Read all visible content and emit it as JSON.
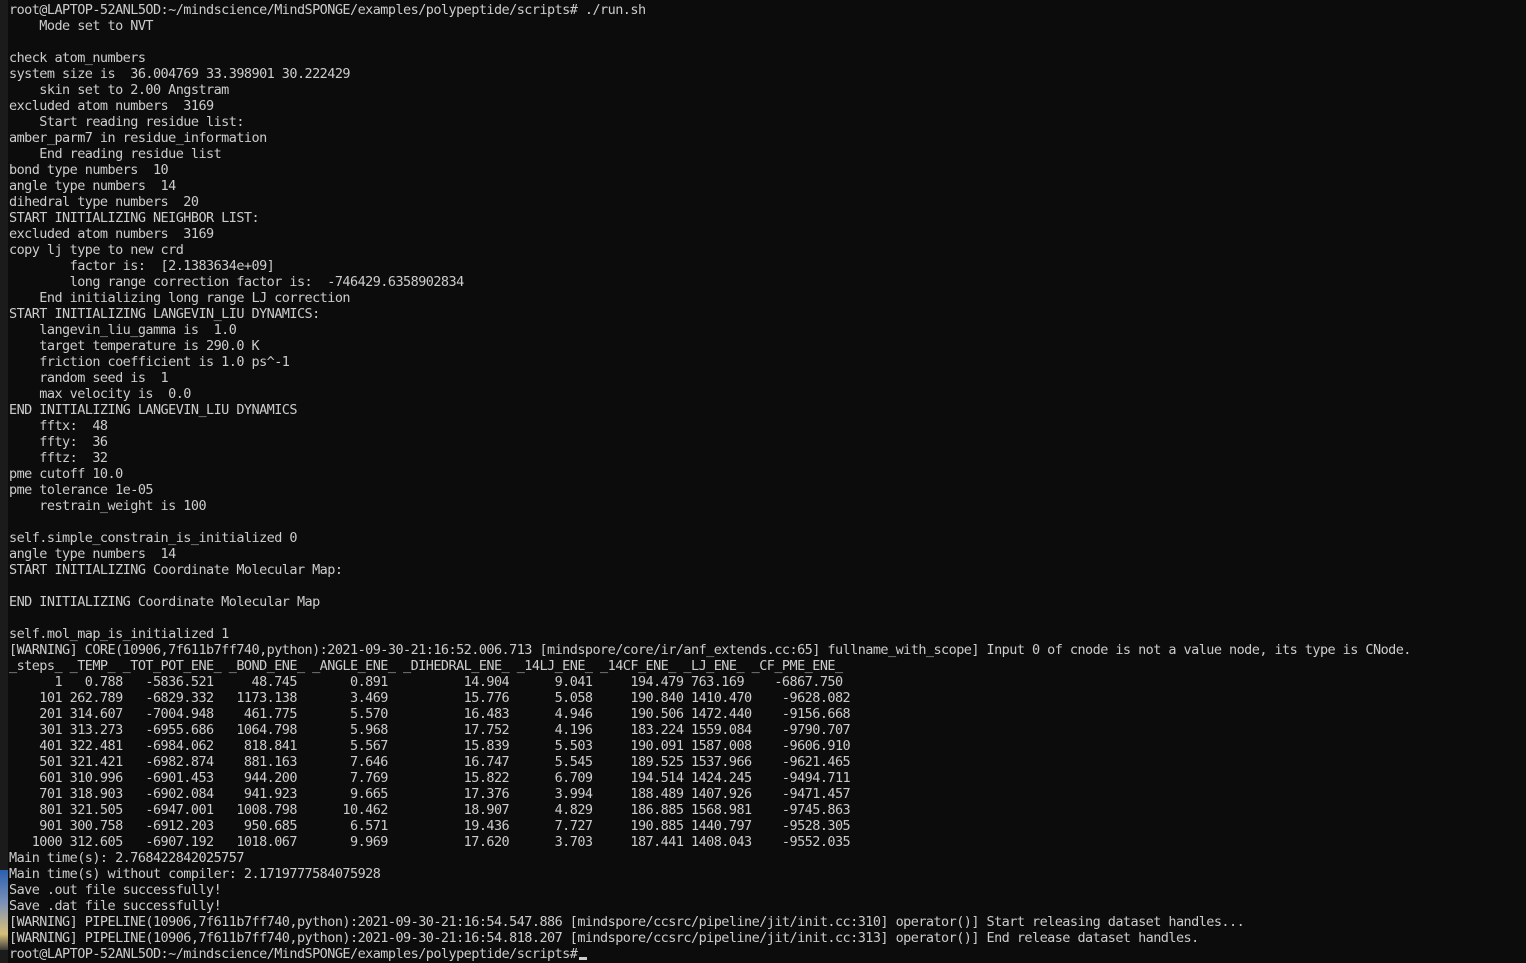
{
  "terminal": {
    "lines": [
      "root@LAPTOP-52ANL5OD:~/mindscience/MindSPONGE/examples/polypeptide/scripts# ./run.sh",
      "    Mode set to NVT",
      "",
      "check atom_numbers",
      "system size is  36.004769 33.398901 30.222429",
      "    skin set to 2.00 Angstram",
      "excluded atom numbers  3169",
      "    Start reading residue list:",
      "amber_parm7 in residue_information",
      "    End reading residue list",
      "bond type numbers  10",
      "angle type numbers  14",
      "dihedral type numbers  20",
      "START INITIALIZING NEIGHBOR LIST:",
      "excluded atom numbers  3169",
      "copy lj type to new crd",
      "        factor is:  [2.1383634e+09]",
      "        long range correction factor is:  -746429.6358902834",
      "    End initializing long range LJ correction",
      "START INITIALIZING LANGEVIN_LIU DYNAMICS:",
      "    langevin_liu_gamma is  1.0",
      "    target temperature is 290.0 K",
      "    friction coefficient is 1.0 ps^-1",
      "    random seed is  1",
      "    max velocity is  0.0",
      "END INITIALIZING LANGEVIN_LIU DYNAMICS",
      "    fftx:  48",
      "    ffty:  36",
      "    fftz:  32",
      "pme cutoff 10.0",
      "pme tolerance 1e-05",
      "    restrain_weight is 100",
      "",
      "self.simple_constrain_is_initialized 0",
      "angle type numbers  14",
      "START INITIALIZING Coordinate Molecular Map:",
      "",
      "END INITIALIZING Coordinate Molecular Map",
      "",
      "self.mol_map_is_initialized 1",
      "[WARNING] CORE(10906,7f611b7ff740,python):2021-09-30-21:16:52.006.713 [mindspore/core/ir/anf_extends.cc:65] fullname_with_scope] Input 0 of cnode is not a value node, its type is CNode.",
      "_steps_ _TEMP_ _TOT_POT_ENE_ _BOND_ENE_ _ANGLE_ENE_ _DIHEDRAL_ENE_ _14LJ_ENE_ _14CF_ENE_ _LJ_ENE_ _CF_PME_ENE_",
      "      1   0.788   -5836.521     48.745       0.891          14.904      9.041     194.479 763.169    -6867.750",
      "    101 262.789   -6829.332   1173.138       3.469          15.776      5.058     190.840 1410.470    -9628.082",
      "    201 314.607   -7004.948    461.775       5.570          16.483      4.946     190.506 1472.440    -9156.668",
      "    301 313.273   -6955.686   1064.798       5.968          17.752      4.196     183.224 1559.084    -9790.707",
      "    401 322.481   -6984.062    818.841       5.567          15.839      5.503     190.091 1587.008    -9606.910",
      "    501 321.421   -6982.874    881.163       7.646          16.747      5.545     189.525 1537.966    -9621.465",
      "    601 310.996   -6901.453    944.200       7.769          15.822      6.709     194.514 1424.245    -9494.711",
      "    701 318.903   -6902.084    941.923       9.665          17.376      3.994     188.489 1407.926    -9471.457",
      "    801 321.505   -6947.001   1008.798      10.462          18.907      4.829     186.885 1568.981    -9745.863",
      "    901 300.758   -6912.203    950.685       6.571          19.436      7.727     190.885 1440.797    -9528.305",
      "   1000 312.605   -6907.192   1018.067       9.969          17.620      3.703     187.441 1408.043    -9552.035",
      "Main time(s): 2.768422842025757",
      "Main time(s) without compiler: 2.1719777584075928",
      "Save .out file successfully!",
      "Save .dat file successfully!",
      "[WARNING] PIPELINE(10906,7f611b7ff740,python):2021-09-30-21:16:54.547.886 [mindspore/ccsrc/pipeline/jit/init.cc:310] operator()] Start releasing dataset handles...",
      "[WARNING] PIPELINE(10906,7f611b7ff740,python):2021-09-30-21:16:54.818.207 [mindspore/ccsrc/pipeline/jit/init.cc:313] operator()] End release dataset handles.",
      "root@LAPTOP-52ANL5OD:~/mindscience/MindSPONGE/examples/polypeptide/scripts#"
    ]
  },
  "colors": {
    "background": "#0c0c0c",
    "foreground": "#cccccc"
  }
}
